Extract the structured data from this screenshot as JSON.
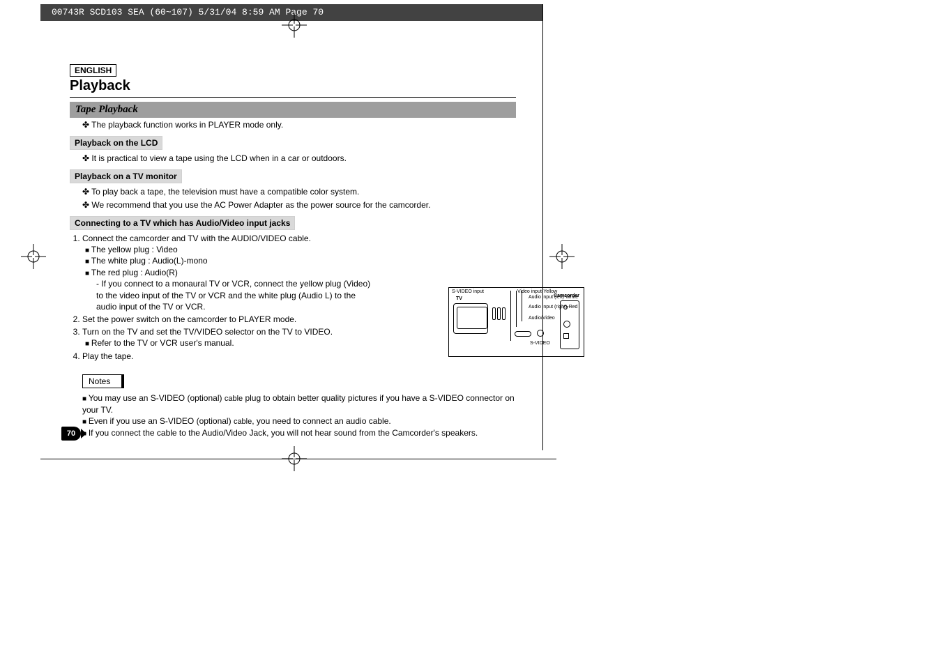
{
  "header": {
    "imprint": "00743R SCD103 SEA (60~107)  5/31/04 8:59 AM  Page 70"
  },
  "page": {
    "language": "ENGLISH",
    "title": "Playback",
    "section": "Tape Playback",
    "intro": "The playback function works in PLAYER mode only.",
    "sub1": {
      "heading": "Playback on the LCD",
      "line1": "It is practical to view a tape using the LCD when in a car or outdoors."
    },
    "sub2": {
      "heading": "Playback on a TV monitor",
      "line1": "To play back a tape, the television must have a compatible color system.",
      "line2": "We recommend that you use the AC Power Adapter as the power source for the camcorder."
    },
    "sub3": {
      "heading": "Connecting to a TV which has Audio/Video input jacks",
      "step1": "Connect the camcorder and TV with the AUDIO/VIDEO cable.",
      "plug_y": "The yellow plug : Video",
      "plug_w": "The white plug : Audio(L)-mono",
      "plug_r": "The red plug : Audio(R)",
      "plug_r_note": "If you connect to a monaural TV or VCR, connect the yellow plug (Video) to the video input of the TV or VCR and the white plug (Audio L) to the audio input of the TV or VCR.",
      "step2": "Set the power switch on the camcorder to PLAYER mode.",
      "step3": "Turn on the TV and set the TV/VIDEO selector on the TV to VIDEO.",
      "step3_note": "Refer to the TV or VCR user's manual.",
      "step4": "Play the tape."
    },
    "notes": {
      "label": "Notes",
      "n1a": "You may use an S-VIDEO (optional) ",
      "n1b": "cable",
      "n1c": " plug to obtain better quality pictures if you have a S-VIDEO connector on your TV.",
      "n2a": "Even if you use an S-VIDEO (optional) ",
      "n2b": "cable",
      "n2c": ", you need to connect an audio cable.",
      "n3": "If you connect the cable to the Audio/Video Jack, you will not hear sound from the Camcorder's speakers."
    },
    "number": "70"
  },
  "diagram": {
    "tv": "TV",
    "cam": "Camcorder",
    "sv_input": "S-VIDEO input",
    "vid_in": "Video input-Yellow",
    "aud_l": "Audio input (left)-White",
    "aud_r": "Audio input (right)-Red",
    "av": "Audio/Video",
    "sv": "S-VIDEO"
  }
}
